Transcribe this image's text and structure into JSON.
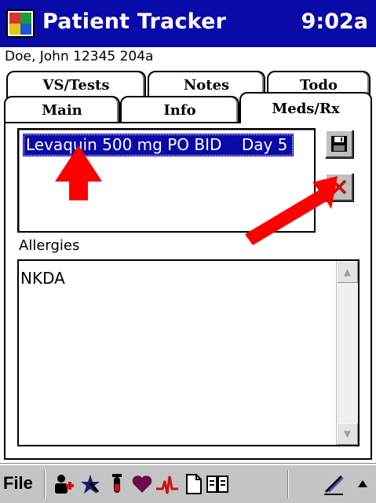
{
  "header": {
    "app_title": "Patient Tracker",
    "clock": "9:02a",
    "icon": "patient-tracker-app-icon"
  },
  "patient": {
    "line": "Doe, John 12345 204a"
  },
  "tabs": {
    "row_back": [
      "VS/Tests",
      "Notes",
      "Todo"
    ],
    "row_front": [
      "Main",
      "Info",
      "Meds/Rx"
    ],
    "active": "Meds/Rx"
  },
  "meds": {
    "items": [
      "Levaquin 500 mg PO BID    Day 5"
    ],
    "selected_index": 0,
    "save_icon": "floppy-disk-icon",
    "delete_icon": "delete-x-icon"
  },
  "allergies": {
    "label": "Allergies",
    "value": "NKDA"
  },
  "annotations": {
    "color": "#ff0000",
    "arrows": [
      "arrow-up-to-med-item",
      "arrow-to-delete-button"
    ]
  },
  "taskbar": {
    "file_label": "File",
    "icons": [
      "patients-icon",
      "procedure-icon",
      "test-tube-icon",
      "heart-icon",
      "ecg-icon",
      "note-page-icon",
      "book-icon",
      "pen-icon",
      "up-arrow-icon"
    ]
  },
  "colors": {
    "title_bar": "#0a0aa8",
    "selection": "#0a0aa8",
    "chrome": "#c0c0c0"
  }
}
